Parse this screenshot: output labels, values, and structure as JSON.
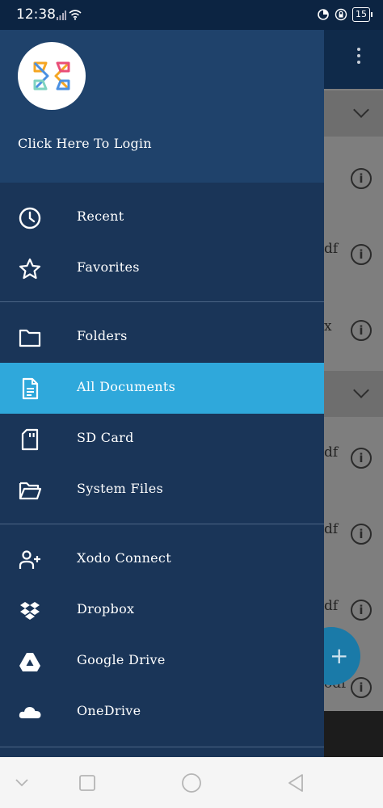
{
  "status_bar": {
    "time": "12:38",
    "battery": "15"
  },
  "drawer": {
    "login_text": "Click Here To Login",
    "items": [
      {
        "label": "Recent",
        "icon": "clock-icon"
      },
      {
        "label": "Favorites",
        "icon": "star-icon"
      },
      {
        "label": "Folders",
        "icon": "folder-icon"
      },
      {
        "label": "All Documents",
        "icon": "document-icon",
        "selected": true
      },
      {
        "label": "SD Card",
        "icon": "sd-card-icon"
      },
      {
        "label": "System Files",
        "icon": "folder-open-icon"
      },
      {
        "label": "Xodo Connect",
        "icon": "add-person-icon"
      },
      {
        "label": "Dropbox",
        "icon": "dropbox-icon"
      },
      {
        "label": "Google Drive",
        "icon": "google-drive-icon"
      },
      {
        "label": "OneDrive",
        "icon": "onedrive-icon"
      }
    ]
  },
  "background": {
    "fragments": [
      "df",
      "x",
      "df",
      "df",
      "df",
      "odf"
    ],
    "fab_label": "+"
  },
  "colors": {
    "drawer": "#1a3558",
    "header": "#1f426b",
    "selected": "#2fa8db"
  }
}
